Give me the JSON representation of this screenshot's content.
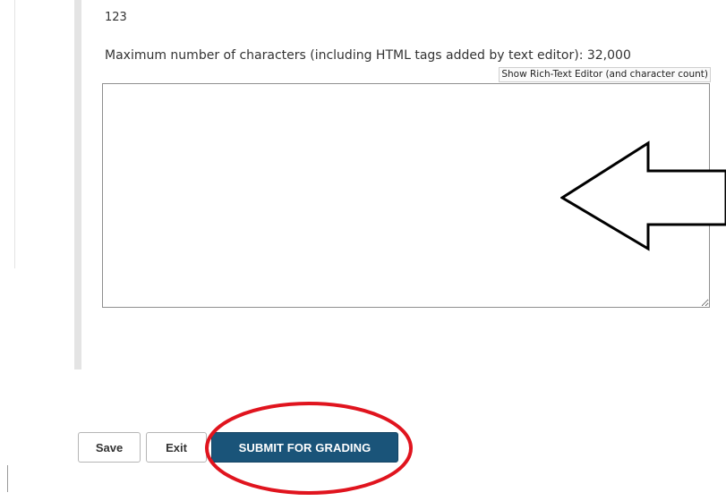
{
  "question": {
    "answer_number": "123",
    "max_chars_text": "Maximum number of characters (including HTML tags added by text editor): 32,000",
    "show_editor_link": "Show Rich-Text Editor (and character count)",
    "answer_value": ""
  },
  "actions": {
    "save_label": "Save",
    "exit_label": "Exit",
    "submit_label": "SUBMIT FOR GRADING"
  },
  "colors": {
    "submit_bg": "#1a5479",
    "annotation_red": "#e0141e",
    "annotation_arrow": "#000000",
    "question_bar": "#e4e4e4"
  }
}
